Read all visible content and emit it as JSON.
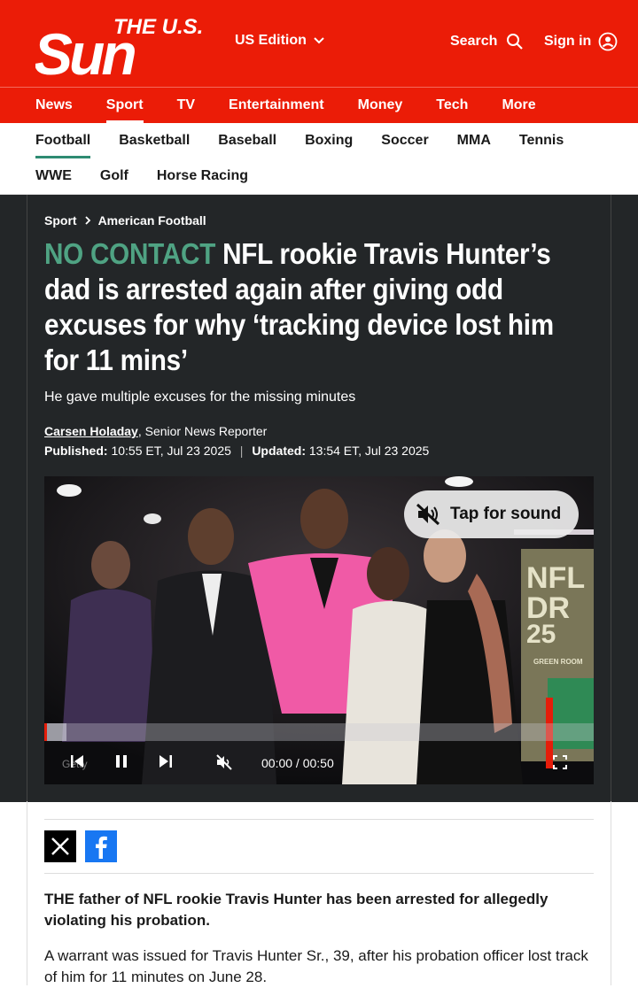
{
  "header": {
    "logo_top": "THE U.S.",
    "logo_main": "Sun",
    "edition_label": "US Edition",
    "search_label": "Search",
    "signin_label": "Sign in"
  },
  "main_nav": [
    {
      "label": "News",
      "active": false
    },
    {
      "label": "Sport",
      "active": true
    },
    {
      "label": "TV",
      "active": false
    },
    {
      "label": "Entertainment",
      "active": false
    },
    {
      "label": "Money",
      "active": false
    },
    {
      "label": "Tech",
      "active": false
    },
    {
      "label": "More",
      "active": false
    }
  ],
  "sub_nav": [
    {
      "label": "Football",
      "active": true
    },
    {
      "label": "Basketball"
    },
    {
      "label": "Baseball"
    },
    {
      "label": "Boxing"
    },
    {
      "label": "Soccer"
    },
    {
      "label": "MMA"
    },
    {
      "label": "Tennis"
    },
    {
      "label": "WWE"
    },
    {
      "label": "Golf"
    },
    {
      "label": "Horse Racing"
    }
  ],
  "article": {
    "breadcrumb": [
      "Sport",
      "American Football"
    ],
    "kicker": "NO CONTACT",
    "headline": "NFL rookie Travis Hunter’s dad is arrested again after giving odd excuses for why ‘tracking device lost him for 11 mins’",
    "standfirst": "He gave multiple excuses for the missing minutes",
    "author": "Carsen Holaday",
    "author_role": ", Senior News Reporter",
    "published_label": "Published:",
    "published": "10:55 ET, Jul 23 2025",
    "updated_label": "Updated:",
    "updated": "13:54 ET, Jul 23 2025",
    "lede": "THE father of NFL rookie Travis Hunter has been arrested for allegedly violating his probation.",
    "paragraph": "A warrant was issued for Travis Hunter Sr., 39, after his probation officer lost track of him for 11 minutes on June 28."
  },
  "video": {
    "tap_for_sound": "Tap for sound",
    "time": "00:00 / 00:50",
    "watermark": "Getty",
    "progress_fraction": 0.04,
    "backdrop_text": [
      "NFL",
      "DR",
      "25",
      "GREEN ROOM"
    ]
  },
  "share": [
    "x-icon",
    "facebook-icon"
  ],
  "colors": {
    "brand_red": "#eb1c07",
    "kicker_green": "#4fa383",
    "hero_bg": "#232628",
    "active_underline": "#2e8b72"
  }
}
